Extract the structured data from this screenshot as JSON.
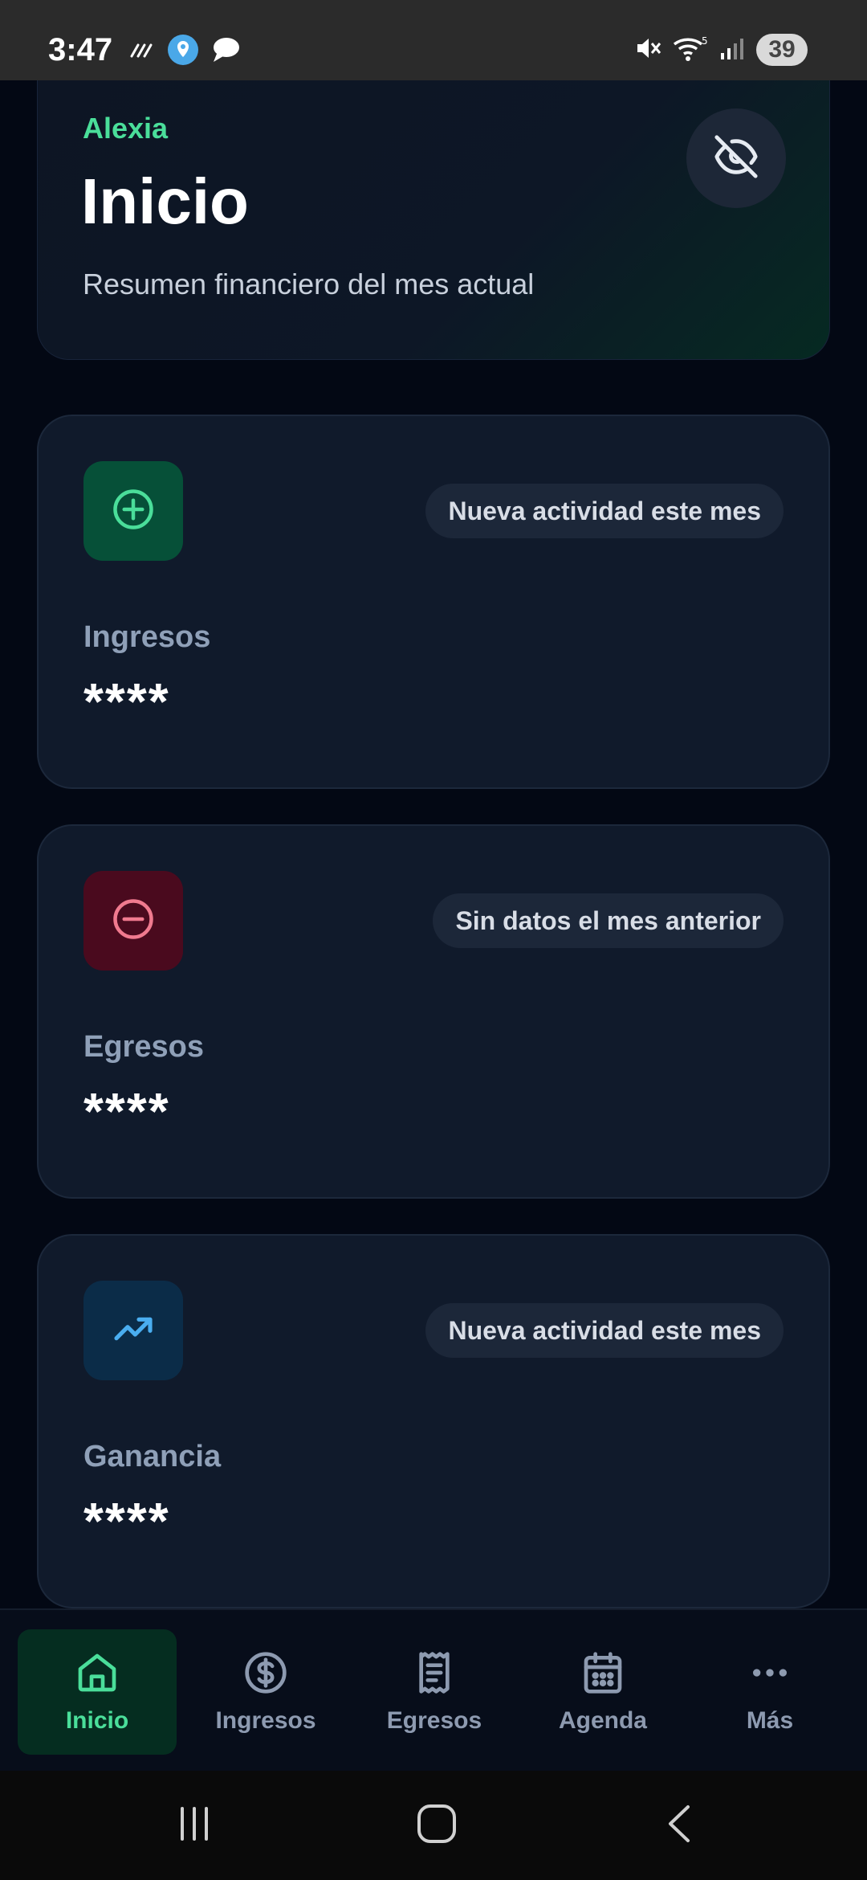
{
  "status_bar": {
    "time": "3:47",
    "battery": "39",
    "icons_left": [
      "drive-mode-icon",
      "location-app-icon",
      "chat-bubble-icon"
    ],
    "icons_right": [
      "mute-icon",
      "wifi-icon",
      "signal-icon"
    ]
  },
  "header": {
    "user_name": "Alexia",
    "title": "Inicio",
    "subtitle": "Resumen financiero del mes actual",
    "toggle_icon": "eye-off-icon"
  },
  "cards": [
    {
      "badge": "Nueva actividad este mes",
      "label": "Ingresos",
      "value": "****",
      "icon": "plus-circle-icon",
      "icon_bg": "#065038",
      "icon_color": "#4ade9a"
    },
    {
      "badge": "Sin datos el mes anterior",
      "label": "Egresos",
      "value": "****",
      "icon": "minus-circle-icon",
      "icon_bg": "#4a0a1e",
      "icon_color": "#f07a8f"
    },
    {
      "badge": "Nueva actividad este mes",
      "label": "Ganancia",
      "value": "****",
      "icon": "trending-up-icon",
      "icon_bg": "#0b2c48",
      "icon_color": "#4aaef0"
    }
  ],
  "nav": {
    "items": [
      {
        "label": "Inicio",
        "icon": "home-icon",
        "active": true
      },
      {
        "label": "Ingresos",
        "icon": "dollar-circle-icon",
        "active": false
      },
      {
        "label": "Egresos",
        "icon": "receipt-icon",
        "active": false
      },
      {
        "label": "Agenda",
        "icon": "calendar-icon",
        "active": false
      },
      {
        "label": "Más",
        "icon": "more-icon",
        "active": false
      }
    ]
  },
  "colors": {
    "accent": "#4ade9a",
    "background": "#030814",
    "card": "#101a2b"
  }
}
